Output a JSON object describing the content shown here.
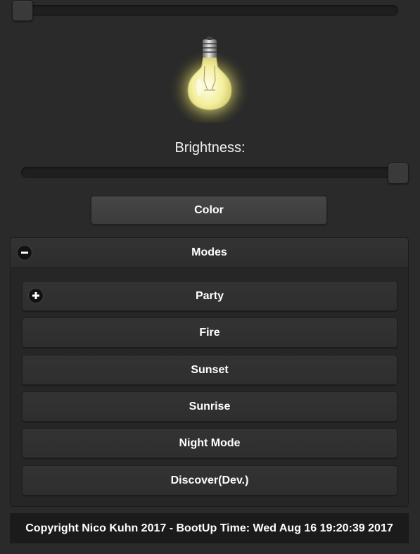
{
  "brightness": {
    "label": "Brightness:",
    "level": 1.0
  },
  "top_slider": {
    "level": 0.0
  },
  "color_button": {
    "label": "Color"
  },
  "modes": {
    "header_label": "Modes",
    "header_icon": "minus-icon",
    "items": [
      {
        "label": "Party",
        "icon": "plus-icon"
      },
      {
        "label": "Fire"
      },
      {
        "label": "Sunset"
      },
      {
        "label": "Sunrise"
      },
      {
        "label": "Night Mode"
      },
      {
        "label": "Discover(Dev.)"
      }
    ]
  },
  "footer": {
    "text": "Copyright Nico Kuhn 2017 - BootUp Time: Wed Aug 16 19:20:39 2017"
  },
  "colors": {
    "background": "#2a2a2a",
    "bulb_glow": "#f4f0a0",
    "footer_background": "#1b1b1b"
  }
}
